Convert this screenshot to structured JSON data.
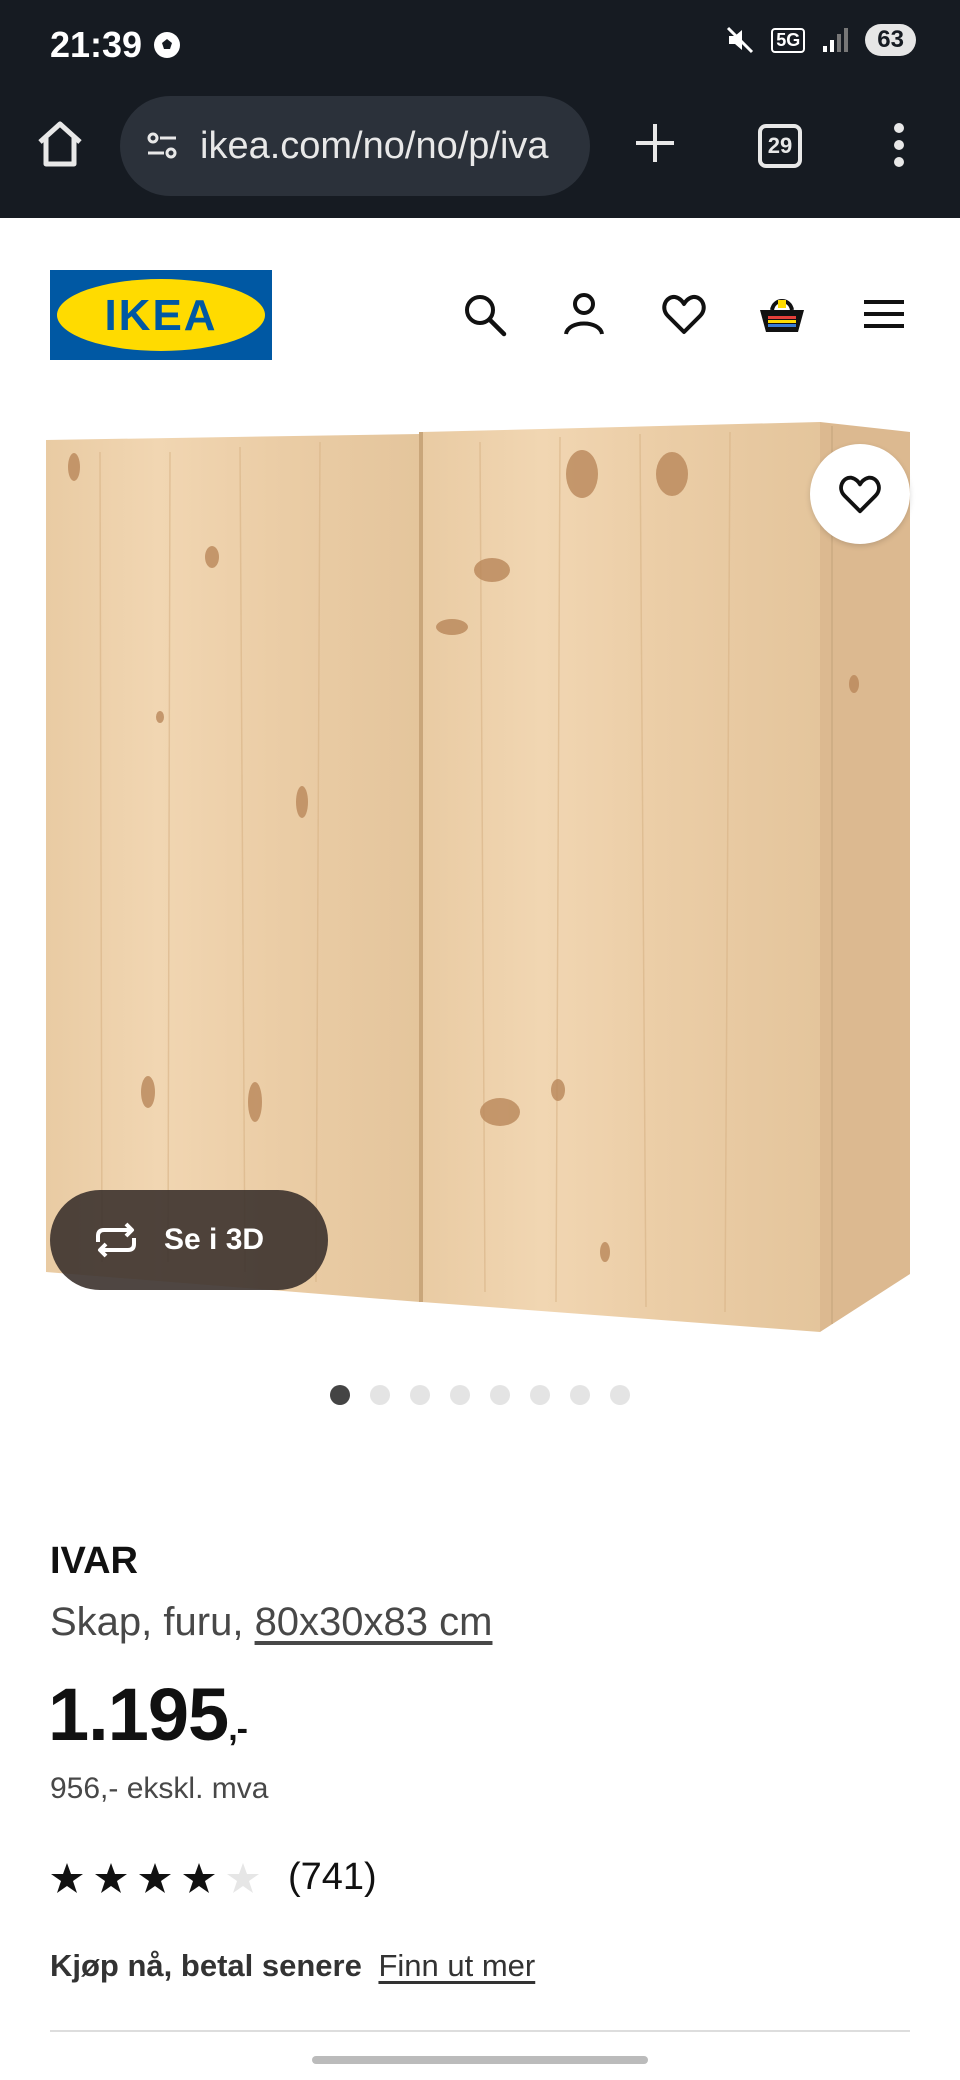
{
  "status_bar": {
    "time": "21:39",
    "network": "5G",
    "battery": "63"
  },
  "browser": {
    "url": "ikea.com/no/no/p/iva",
    "tab_count": "29"
  },
  "header": {
    "logo_text": "IKEA",
    "logo_colors": {
      "blue": "#0058a3",
      "yellow": "#ffdb00"
    }
  },
  "gallery": {
    "see_3d_label": "Se i 3D",
    "image_count": 8,
    "active_index": 0
  },
  "product": {
    "name": "IVAR",
    "desc_prefix": "Skap, furu, ",
    "dimensions": "80x30x83 cm",
    "price": "1.195",
    "price_suffix": ",-",
    "price_ex_vat": "956,- ekskl. mva",
    "rating_value": 4,
    "rating_max": 5,
    "review_count": "(741)"
  },
  "financing": {
    "label": "Kjøp nå, betal senere",
    "link": "Finn ut mer"
  }
}
